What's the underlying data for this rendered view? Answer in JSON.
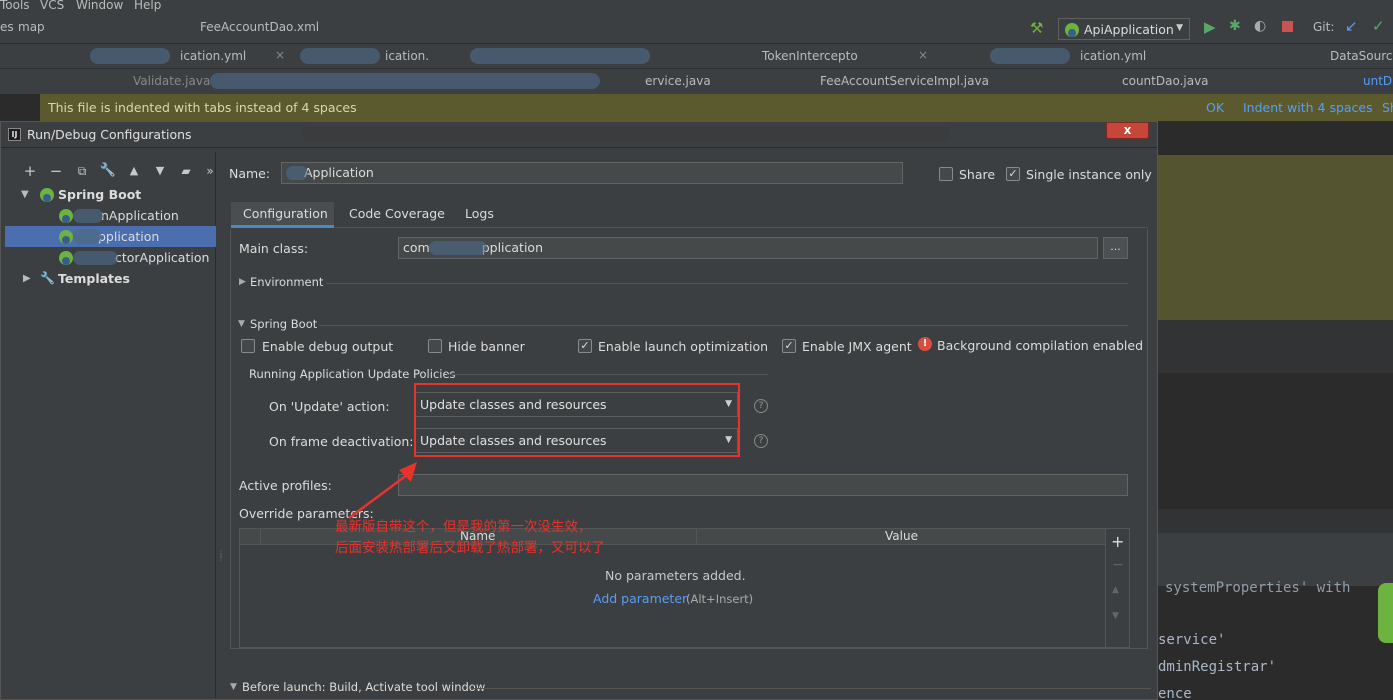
{
  "menu": {
    "items": [
      "Tools",
      "VCS",
      "Window",
      "Help"
    ]
  },
  "toolbar": {
    "breadcrumb": [
      "map",
      "FeeAccountDao.xml"
    ],
    "run_config": "ApiApplication",
    "git_label": "Git:"
  },
  "editor_tabs_row1": [
    "ication.yml",
    "ication.",
    "TokenIntercepto",
    "ication.yml",
    "DataSourceCon"
  ],
  "editor_tabs_row2": [
    "Validate.java",
    "ervice.java",
    "FeeAccountServiceImpl.java",
    "countDao.java",
    "untD"
  ],
  "notice": {
    "text": "This file is indented with tabs instead of 4 spaces",
    "ok": "OK",
    "indent": "Indent with 4 spaces",
    "more": "Sh"
  },
  "editor_code": [
    "systemProperties' with",
    "service'",
    "dminRegistrar'",
    "ence"
  ],
  "dialog": {
    "title": "Run/Debug Configurations",
    "close": "x"
  },
  "tree": {
    "root": "Spring Boot",
    "items": [
      "nApplication",
      "pplication",
      "ctorApplication"
    ],
    "templates": "Templates"
  },
  "config": {
    "name_label": "Name:",
    "name_value": "Application",
    "share_label": "Share",
    "single_instance_label": "Single instance only",
    "tabs": [
      "Configuration",
      "Code Coverage",
      "Logs"
    ],
    "main_class_label": "Main class:",
    "main_class_value_prefix": "com",
    "main_class_value_suffix": "pplication",
    "browse": "...",
    "environment_label": "Environment",
    "spring_boot_label": "Spring Boot",
    "enable_debug_output": "Enable debug output",
    "hide_banner": "Hide banner",
    "enable_launch_optimization": "Enable launch optimization",
    "enable_jmx_agent": "Enable JMX agent",
    "background_compilation": "Background compilation enabled",
    "policies_label": "Running Application Update Policies",
    "on_update_label": "On 'Update' action:",
    "on_update_value": "Update classes and resources",
    "on_frame_label": "On frame deactivation:",
    "on_frame_value": "Update classes and resources",
    "active_profiles_label": "Active profiles:",
    "override_label": "Override parameters:",
    "col_name": "Name",
    "col_value": "Value",
    "no_params": "No parameters added.",
    "add_param": "Add parameter",
    "add_param_hint": "(Alt+Insert)",
    "before_launch": "Before launch: Build, Activate tool window"
  },
  "annotation": {
    "line1": "最新版自带这个，但是我的第一次没生效，",
    "line2": "后面安装热部署后又卸载了热部署，又可以了"
  },
  "colors": {
    "accent": "#4b6eaf",
    "annotation": "#e8322c",
    "spring": "#6db33f"
  }
}
